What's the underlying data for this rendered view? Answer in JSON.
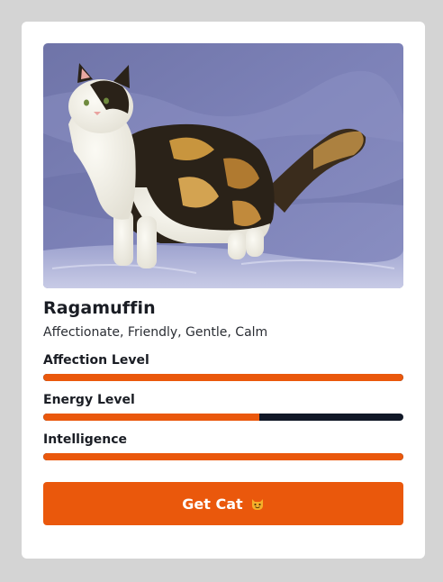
{
  "breed": {
    "name": "Ragamuffin",
    "temperament": "Affectionate, Friendly, Gentle, Calm"
  },
  "stats": [
    {
      "label": "Affection Level",
      "fraction": 1.0
    },
    {
      "label": "Energy Level",
      "fraction": 0.6
    },
    {
      "label": "Intelligence",
      "fraction": 1.0
    }
  ],
  "button": {
    "label": "Get Cat",
    "icon": "smiling-cat-emoji-icon"
  },
  "colors": {
    "accent": "#ea580c",
    "track": "#111827",
    "background": "#d4d4d4",
    "card": "#ffffff"
  }
}
